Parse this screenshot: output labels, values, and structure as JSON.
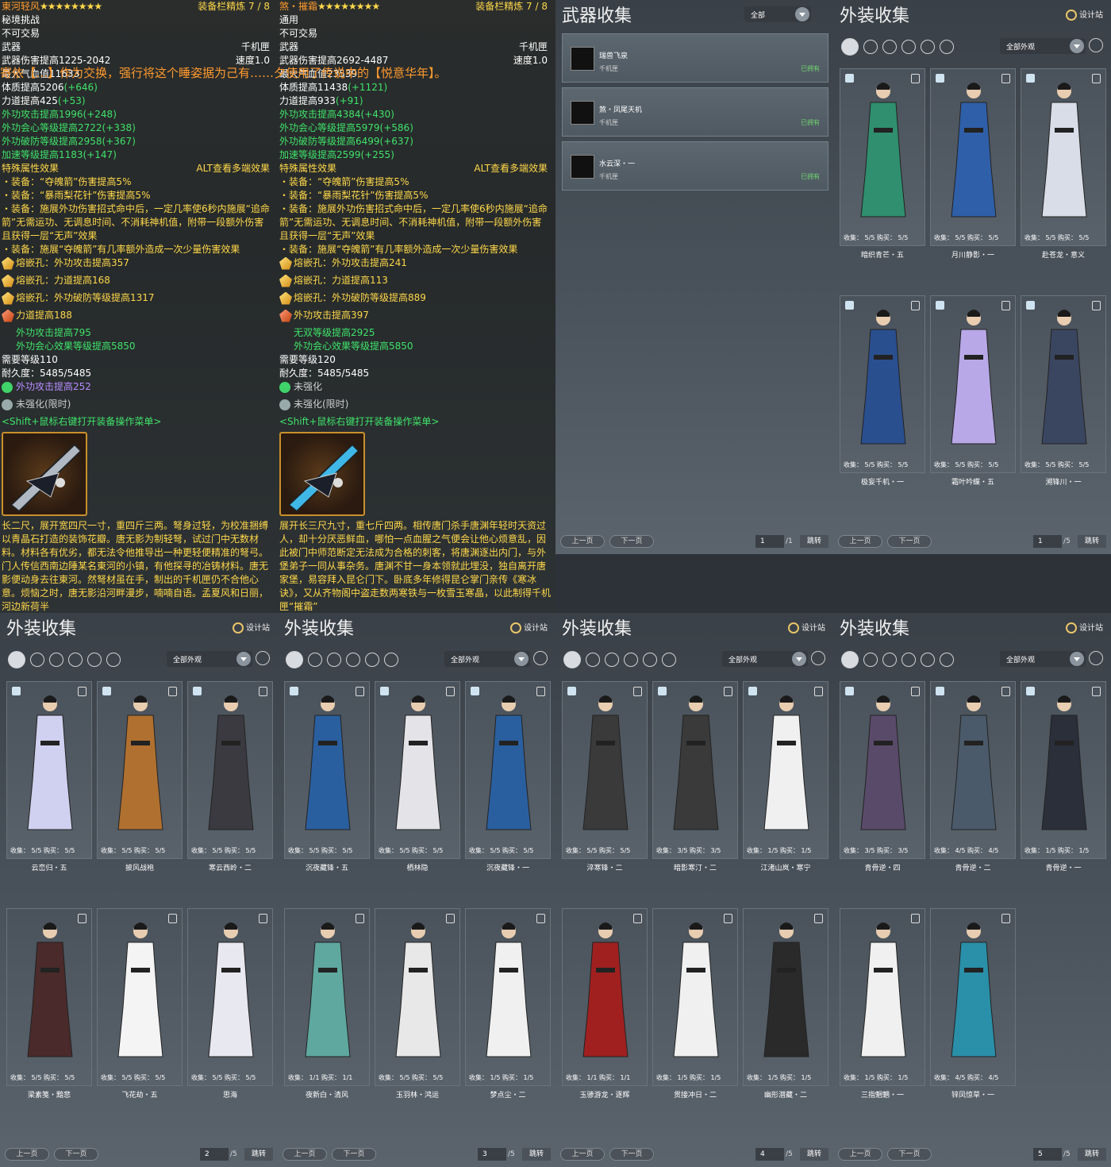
{
  "tooltips": {
    "overlay_text": "寄依【…】作为交换，强行将这个睡姿据为己有……夕使用了传说中的【悦意华年】。",
    "left": {
      "name": "東河轻风",
      "stars": "★★★★★★★★",
      "refine": "装备栏精炼 7 / 8",
      "source": "秘境挑战",
      "bind": "不可交易",
      "slot": "武器",
      "type": "千机匣",
      "damage": "武器伤害提高1225-2042",
      "speed": "速度1.0",
      "hidden_line": "最大气血值11633",
      "attrs": [
        {
          "t": "体质提高5206",
          "b": "(+646)"
        },
        {
          "t": "力道提高425",
          "b": "(+53)"
        },
        {
          "t": "外功攻击提高1996",
          "b": "(+248)"
        },
        {
          "t": "外功会心等级提高2722",
          "b": "(+338)"
        },
        {
          "t": "外功破防等级提高2958",
          "b": "(+367)"
        },
        {
          "t": "加速等级提高1183",
          "b": "(+147)"
        }
      ],
      "special_title": "特殊属性效果",
      "alt_hint": "ALT查看多端效果",
      "effects": [
        "・装备：“夺魄箭”伤害提高5%",
        "・装备：“暴雨梨花针”伤害提高5%",
        "・装备：施展外功伤害招式命中后，一定几率使6秒内施展“追命箭”无需运功、无调息时间、不消耗神机值，附带一段额外伤害且获得一层“无声”效果",
        "・装备：施展“夺魄箭”有几率额外造成一次少量伤害效果"
      ],
      "gems": [
        "熔嵌孔：外功攻击提高357",
        "熔嵌孔：力道提高168",
        "熔嵌孔：外功破防等级提高1317"
      ],
      "enchant_main": "力道提高188",
      "enchant_subs": [
        "外功攻击提高795",
        "外功会心效果等级提高5850"
      ],
      "level": "需要等级110",
      "durability": "耐久度：5485/5485",
      "temp_enchant": "外功攻击提高252",
      "unstrengthen": "未强化(限时)",
      "shift_hint": "<Shift+鼠标右键打开装备操作菜单>",
      "desc": "长二尺，展开宽四尺一寸，重四斤三两。弩身过轻，为校准捆缚以青晶石打造的装饰花瓣。唐无影为制轻弩，试过门中无数材料。材料各有优劣，都无法令他推导出一种更轻便精准的弩弓。门人传信西南边陲某名東河的小镇，有他探寻的冶铸材料。唐无影便动身去往東河。然弩材虽在手，制出的千机匣仍不合他心意。烦恼之时，唐无影沿河畔漫步，喃喃自语。孟夏风和日丽，河边新荷半"
    },
    "right": {
      "name": "煞・摧霜",
      "stars": "★★★★★★★★",
      "refine": "装备栏精炼 7 / 8",
      "source": "通用",
      "bind": "不可交易",
      "slot": "武器",
      "type": "千机匣",
      "damage": "武器伤害提高2692-4487",
      "speed": "速度1.0",
      "hidden_line": "最大气血值23539",
      "attrs": [
        {
          "t": "体质提高11438",
          "b": "(+1121)"
        },
        {
          "t": "力道提高933",
          "b": "(+91)"
        },
        {
          "t": "外功攻击提高4384",
          "b": "(+430)"
        },
        {
          "t": "外功会心等级提高5979",
          "b": "(+586)"
        },
        {
          "t": "外功破防等级提高6499",
          "b": "(+637)"
        },
        {
          "t": "加速等级提高2599",
          "b": "(+255)"
        }
      ],
      "special_title": "特殊属性效果",
      "alt_hint": "ALT查看多端效果",
      "effects": [
        "・装备：“夺魄箭”伤害提高5%",
        "・装备：“暴雨梨花针”伤害提高5%",
        "・装备：施展外功伤害招式命中后，一定几率使6秒内施展“追命箭”无需运功、无调息时间、不消耗神机值，附带一段额外伤害且获得一层“无声”效果",
        "・装备：施展“夺魄箭”有几率额外造成一次少量伤害效果"
      ],
      "gems": [
        "熔嵌孔：外功攻击提高241",
        "熔嵌孔：力道提高113",
        "熔嵌孔：外功破防等级提高889"
      ],
      "enchant_main": "外功攻击提高397",
      "enchant_subs": [
        "无双等级提高2925",
        "外功会心效果等级提高5850"
      ],
      "level": "需要等级120",
      "durability": "耐久度：5485/5485",
      "temp_enchant": "未强化",
      "unstrengthen": "未强化(限时)",
      "shift_hint": "<Shift+鼠标右键打开装备操作菜单>",
      "desc": "展开长三尺九寸，重七斤四两。相传唐门杀手唐渊年轻时天资过人，却十分厌恶鲜血，哪怕一点血腥之气便会让他心烦意乱，因此被门中师范断定无法成为合格的刺客，将唐渊逐出内门，与外堡弟子一同从事杂务。唐渊不甘一身本领就此埋没，独自离开唐家堡，易容拜入昆仑门下。卧底多年修得昆仑掌门亲传《寒冰诀》，又从齐物阁中盗走数两寒铁与一枚雪玉寒晶，以此制得千机匣“摧霜”"
    }
  },
  "weapon_panel": {
    "title": "武器收集",
    "filter": "全部",
    "items": [
      {
        "name": "瑞兽飞泉",
        "type": "千机匣",
        "status": "已拥有"
      },
      {
        "name": "煞・凤尾天机",
        "type": "千机匣",
        "status": "已拥有"
      },
      {
        "name": "水云深・一",
        "type": "千机匣",
        "status": "已拥有"
      }
    ],
    "pager": {
      "prev": "上一页",
      "next": "下一页",
      "page": "1",
      "total": "/1",
      "jump": "跳转"
    }
  },
  "outfit_panels": [
    {
      "title": "外装收集",
      "designer": "设计站",
      "filter": "全部外观",
      "pager": {
        "prev": "上一页",
        "next": "下一页",
        "page": "1",
        "total": "/5",
        "jump": "跳转"
      },
      "cards": [
        {
          "name": "暗织青芒・五",
          "stat": "收集： 5/5  购买： 5/5",
          "color": "#2f8f6f"
        },
        {
          "name": "月川静影・一",
          "stat": "收集： 5/5  购买： 5/5",
          "color": "#2f5fa8"
        },
        {
          "name": "赴苍龙・意义",
          "stat": "收集： 5/5  购买： 5/5",
          "color": "#d8dde8"
        },
        {
          "name": "极妄千机・一",
          "stat": "收集： 5/5  购买： 5/5",
          "color": "#2a4f8f"
        },
        {
          "name": "霜叶吟蝶・五",
          "stat": "收集： 5/5  购买： 5/5",
          "color": "#b8a8e8"
        },
        {
          "name": "溯锋川・一",
          "stat": "收集： 5/5  购买： 5/5",
          "color": "#3a4660"
        }
      ]
    },
    {
      "title": "外装收集",
      "designer": "设计站",
      "filter": "全部外观",
      "pager": {
        "prev": "上一页",
        "next": "下一页",
        "page": "2",
        "total": "/5",
        "jump": "跳转"
      },
      "cards": [
        {
          "name": "云峦归・五",
          "stat": "收集： 5/5  购买： 5/5",
          "color": "#d0d0f0"
        },
        {
          "name": "披风战袍",
          "stat": "收集： 5/5  购买： 5/5",
          "color": "#b07030"
        },
        {
          "name": "寒云西岭・二",
          "stat": "收集： 5/5  购买： 5/5",
          "color": "#3a3a40"
        },
        {
          "name": "梁素笺・黯悲",
          "stat": "收集： 5/5  购买： 5/5",
          "color": "#4a2a2a"
        },
        {
          "name": "飞花劫・五",
          "stat": "收集： 5/5  购买： 5/5",
          "color": "#f4f4f4"
        },
        {
          "name": "思海",
          "stat": "收集： 5/5  购买： 5/5",
          "color": "#e8e8f0"
        }
      ]
    },
    {
      "title": "外装收集",
      "designer": "设计站",
      "filter": "全部外观",
      "pager": {
        "prev": "上一页",
        "next": "下一页",
        "page": "3",
        "total": "/5",
        "jump": "跳转"
      },
      "cards": [
        {
          "name": "沉夜藏锋・五",
          "stat": "收集： 5/5  购买： 5/5",
          "color": "#2a5f9f"
        },
        {
          "name": "栖林隐",
          "stat": "收集： 5/5  购买： 5/5",
          "color": "#e4e4e8"
        },
        {
          "name": "沉夜藏锋・一",
          "stat": "收集： 5/5  购买： 5/5",
          "color": "#2a5f9f"
        },
        {
          "name": "夜新白・清风",
          "stat": "收集： 1/1  购买： 1/1",
          "color": "#5fa8a0"
        },
        {
          "name": "玉羽林・鸿运",
          "stat": "收集： 5/5  购买： 5/5",
          "color": "#e8e8e8"
        },
        {
          "name": "梦点尘・二",
          "stat": "收集： 1/5  购买： 1/5",
          "color": "#f0f0f0"
        }
      ]
    },
    {
      "title": "外装收集",
      "designer": "设计站",
      "filter": "全部外观",
      "pager": {
        "prev": "上一页",
        "next": "下一页",
        "page": "4",
        "total": "/5",
        "jump": "跳转"
      },
      "cards": [
        {
          "name": "淬寒锋・二",
          "stat": "收集： 5/5  购买： 5/5",
          "color": "#3a3a3a"
        },
        {
          "name": "暗影寒汀・二",
          "stat": "收集： 3/5  购买： 3/5",
          "color": "#3a3a3a"
        },
        {
          "name": "江渚山岚・寒宁",
          "stat": "收集： 1/5  购买： 1/5",
          "color": "#f0f0f0"
        },
        {
          "name": "玉骖游龙・逐辉",
          "stat": "收集： 1/1  购买： 1/1",
          "color": "#a02020"
        },
        {
          "name": "贯接冲日・二",
          "stat": "收集： 1/5  购买： 1/5",
          "color": "#f0f0f0"
        },
        {
          "name": "幽形潜藏・二",
          "stat": "收集： 1/5  购买： 1/5",
          "color": "#2a2a2a"
        }
      ]
    },
    {
      "title": "外装收集",
      "designer": "设计站",
      "filter": "全部外观",
      "pager": {
        "prev": "上一页",
        "next": "下一页",
        "page": "5",
        "total": "/5",
        "jump": "跳转"
      },
      "cards": [
        {
          "name": "青骨逆・四",
          "stat": "收集： 3/5  购买： 3/5",
          "color": "#5a4a6a"
        },
        {
          "name": "青骨逆・二",
          "stat": "收集： 4/5  购买： 4/5",
          "color": "#4a5a6a"
        },
        {
          "name": "青骨逆・一",
          "stat": "收集： 1/5  购买： 1/5",
          "color": "#2a2f3a"
        },
        {
          "name": "三指魍魉・一",
          "stat": "收集： 1/5  购买： 1/5",
          "color": "#f0f0f0"
        },
        {
          "name": "锌凤惊草・一",
          "stat": "收集： 4/5  购买： 4/5",
          "color": "#2a8fa8"
        }
      ]
    }
  ]
}
